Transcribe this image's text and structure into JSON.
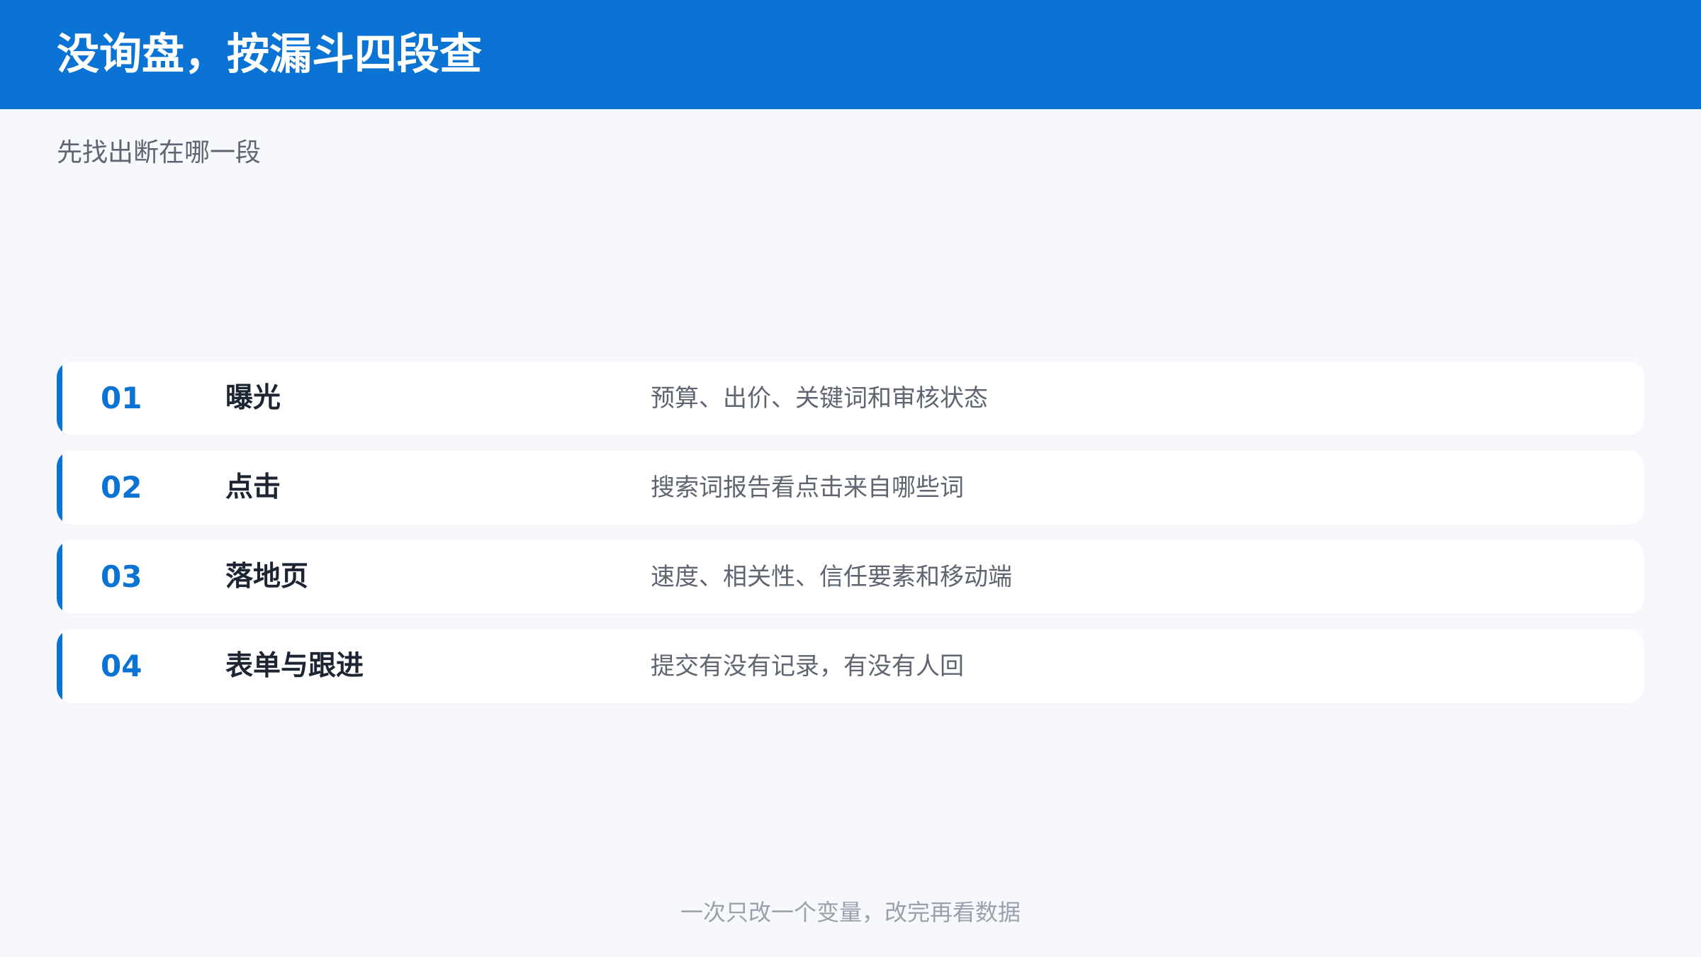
{
  "header": {
    "title": "没询盘，按漏斗四段查",
    "background_color": "#0b73d4"
  },
  "subtitle": "先找出断在哪一段",
  "steps": [
    {
      "number": "01",
      "title": "曝光",
      "description": "预算、出价、关键词和审核状态"
    },
    {
      "number": "02",
      "title": "点击",
      "description": "搜索词报告看点击来自哪些词"
    },
    {
      "number": "03",
      "title": "落地页",
      "description": "速度、相关性、信任要素和移动端"
    },
    {
      "number": "04",
      "title": "表单与跟进",
      "description": "提交有没有记录，有没有人回"
    }
  ],
  "footer_note": "一次只改一个变量，改完再看数据",
  "colors": {
    "accent": "#0b73d4",
    "page_background": "#f6f8fc",
    "card_background": "#ffffff",
    "title_text": "#1d2432",
    "body_text": "#5f6672",
    "muted_text": "#9aa1ac"
  }
}
